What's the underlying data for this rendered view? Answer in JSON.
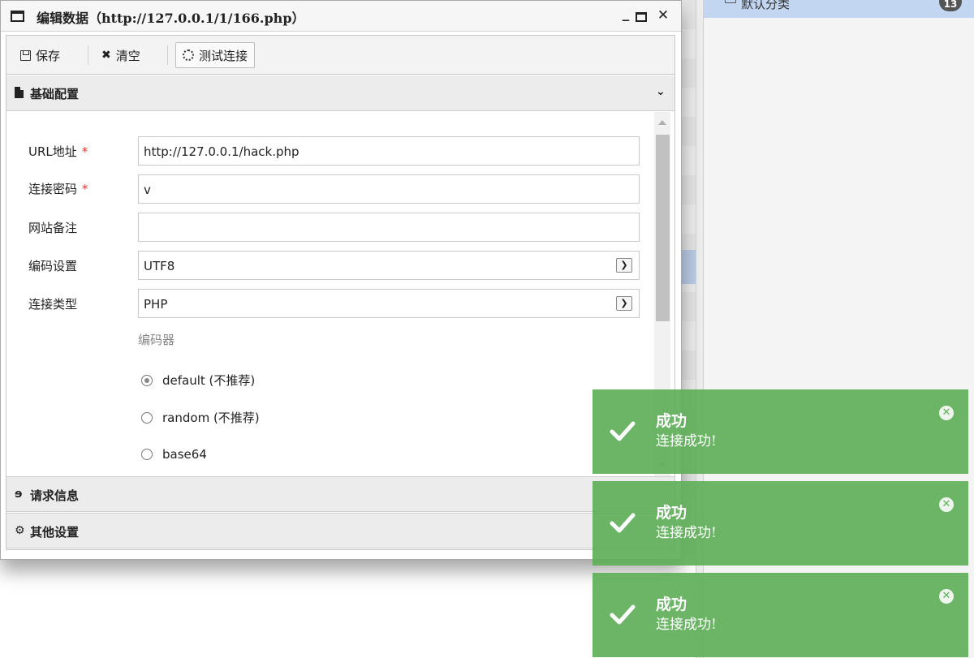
{
  "background": {
    "category_label": "默认分类",
    "category_count": "13"
  },
  "dialog": {
    "title": "编辑数据（http://127.0.0.1/1/166.php）",
    "minimize": "_",
    "close": "✕"
  },
  "toolbar": {
    "save_label": "保存",
    "clear_label": "清空",
    "test_label": "测试连接"
  },
  "sections": {
    "basic": "基础配置",
    "request": "请求信息",
    "other": "其他设置"
  },
  "form": {
    "url_label": "URL地址",
    "url_value": "http://127.0.0.1/hack.php",
    "password_label": "连接密码",
    "password_value": "v",
    "note_label": "网站备注",
    "note_value": "",
    "encoding_label": "编码设置",
    "encoding_value": "UTF8",
    "type_label": "连接类型",
    "type_value": "PHP",
    "required_mark": "*",
    "encoder_title": "编码器",
    "encoders": [
      {
        "label": "default (不推荐)",
        "checked": true
      },
      {
        "label": "random (不推荐)",
        "checked": false
      },
      {
        "label": "base64",
        "checked": false
      }
    ]
  },
  "toasts": [
    {
      "title": "成功",
      "message": "连接成功!"
    },
    {
      "title": "成功",
      "message": "连接成功!"
    },
    {
      "title": "成功",
      "message": "连接成功!"
    }
  ],
  "icons": {
    "window": "window-icon",
    "save": "floppy-icon",
    "clear": "x-icon",
    "test": "spinner-icon",
    "basic": "document-icon",
    "request": "ie-icon",
    "other": "gears-icon",
    "toast_success": "check-icon",
    "toast_close": "close-circle-icon"
  },
  "colors": {
    "toast_bg": "#60af5a",
    "required": "#e53935",
    "selected_category": "#c3d6f1"
  }
}
